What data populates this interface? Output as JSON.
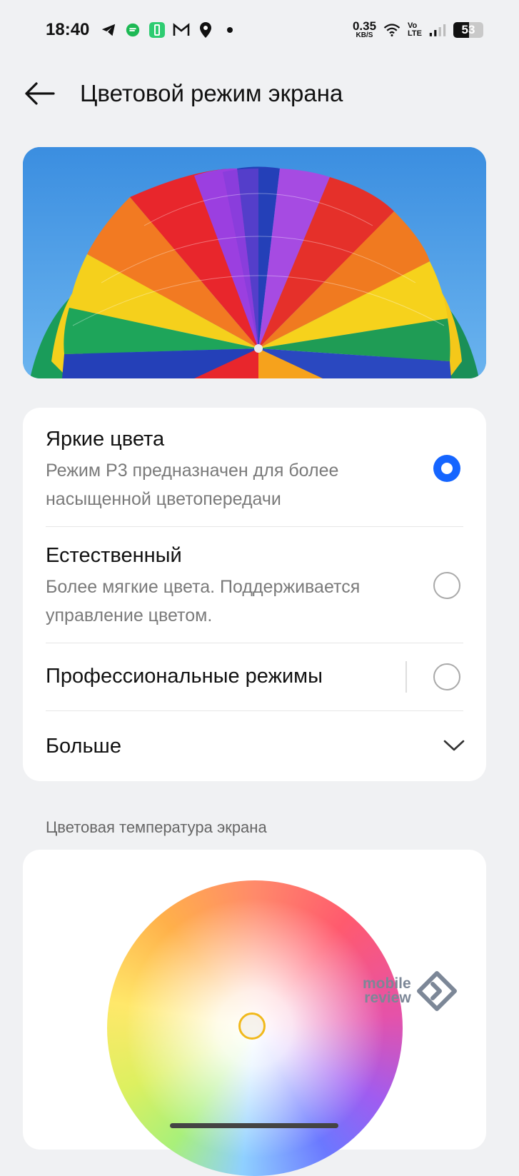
{
  "status_bar": {
    "time": "18:40",
    "left_icons": [
      "telegram-icon",
      "messenger-icon",
      "battery-saver-icon",
      "gmail-icon",
      "location-icon",
      "dot-icon"
    ],
    "net_speed_value": "0.35",
    "net_speed_unit": "KB/S",
    "volte_top": "Vo",
    "volte_bottom": "LTE",
    "battery_level": "53",
    "battery_fraction": 0.53
  },
  "header": {
    "title": "Цветовой режим экрана"
  },
  "modes": [
    {
      "title": "Яркие цвета",
      "description": "Режим P3 предназначен для более насыщенной цветопередачи",
      "selected": true
    },
    {
      "title": "Естественный",
      "description": "Более мягкие цвета. Поддерживается управление цветом.",
      "selected": false
    },
    {
      "title": "Профессиональные режимы",
      "description": "",
      "selected": false
    }
  ],
  "more": {
    "label": "Больше"
  },
  "temperature": {
    "section_label": "Цветовая температура экрана"
  },
  "watermark": {
    "line1": "mobile",
    "line2": "review"
  },
  "colors": {
    "accent": "#1565ff",
    "handle": "#f1b91c",
    "background": "#f0f1f3"
  }
}
